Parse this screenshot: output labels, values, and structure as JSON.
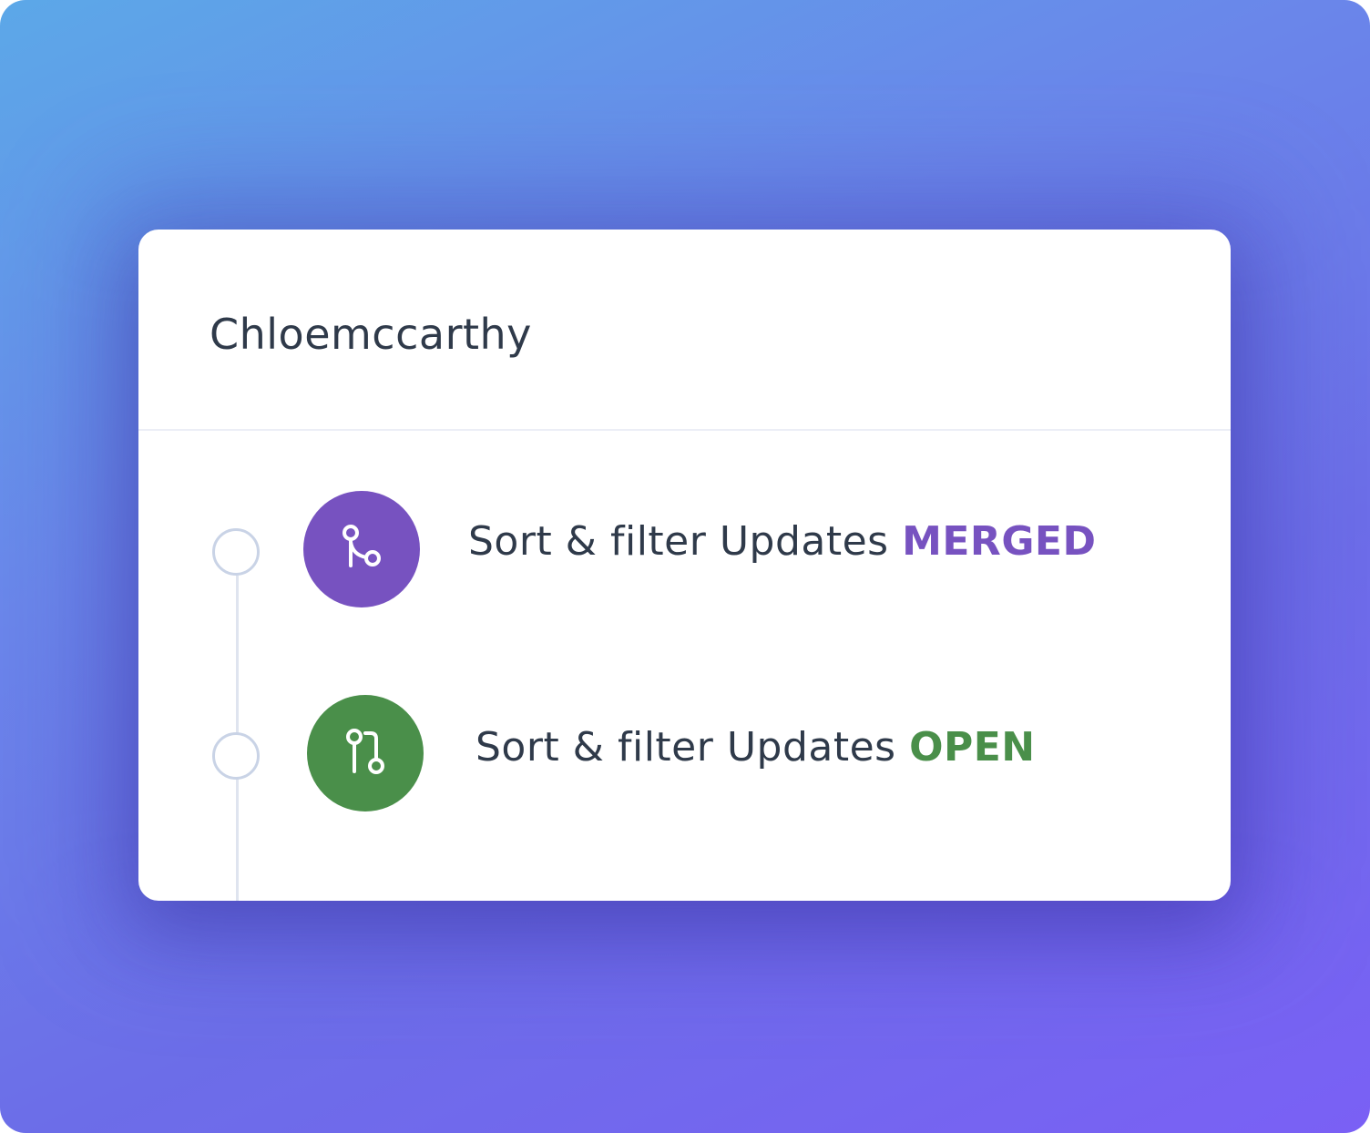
{
  "card": {
    "title": "Chloemccarthy"
  },
  "activity": [
    {
      "text": "Sort & filter Updates",
      "status": "MERGED",
      "status_color": "#7752c0",
      "badge_color": "#7752c0",
      "icon": "git-merge-icon"
    },
    {
      "text": "Sort & filter Updates",
      "status": "OPEN",
      "status_color": "#4a8f4a",
      "badge_color": "#4a8f4a",
      "icon": "git-pull-request-icon"
    }
  ],
  "colors": {
    "background_gradient": [
      "#5ca8e8",
      "#6c6de8",
      "#7a60f5"
    ],
    "card": "#ffffff",
    "text": "#2f3a4a",
    "timeline": "#dfe4ef"
  }
}
